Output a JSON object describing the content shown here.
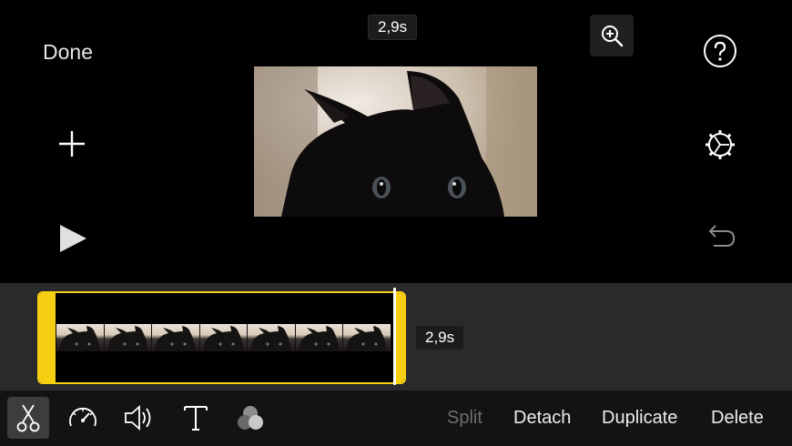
{
  "header": {
    "done_label": "Done",
    "duration_top": "2,9s"
  },
  "icons": {
    "zoom": "zoom-in-icon",
    "help": "question-mark-icon",
    "settings": "gear-icon",
    "undo": "undo-icon",
    "add": "plus-icon",
    "play": "play-icon"
  },
  "timeline": {
    "clip_duration": "2,9s",
    "frame_count": 7
  },
  "toolbar": {
    "tools": [
      "scissors-icon",
      "speedometer-icon",
      "speaker-icon",
      "text-icon",
      "filters-icon"
    ],
    "actions": {
      "split": "Split",
      "detach": "Detach",
      "duplicate": "Duplicate",
      "delete": "Delete"
    }
  },
  "colors": {
    "accent_yellow": "#f6cf12",
    "timeline_bg": "#2a2a2c",
    "toolbar_bg": "#131313"
  }
}
